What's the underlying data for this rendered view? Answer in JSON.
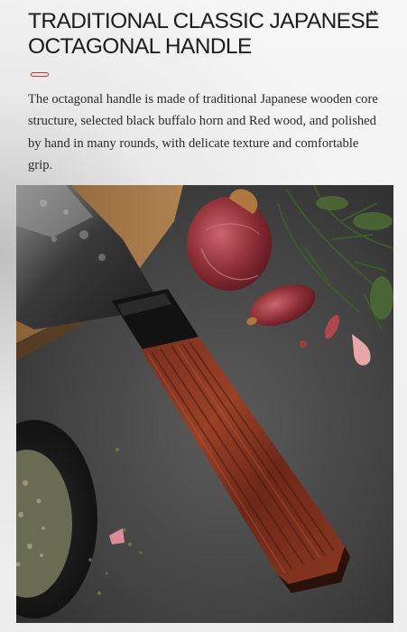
{
  "heading": {
    "line1": "TRADITIONAL CLASSIC JAPANESE",
    "line2": "OCTAGONAL HANDLE",
    "quote": "”"
  },
  "description": "The octagonal handle is made of traditional Japanese wooden core structure, selected black buffalo horn and Red wood, and polished by hand in many rounds, with delicate texture and comfortable grip.",
  "colors": {
    "accent": "#c0392b",
    "text": "#1c1c1c"
  }
}
